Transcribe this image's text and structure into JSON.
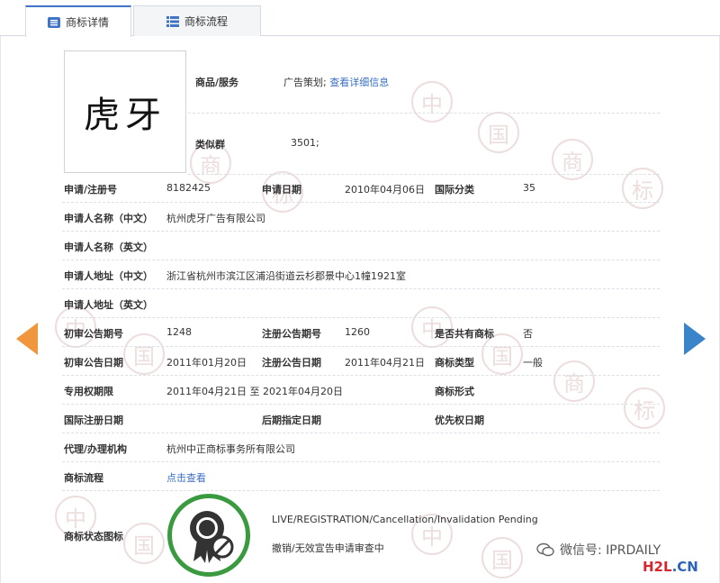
{
  "tabs": [
    {
      "label": "商标详情",
      "active": true,
      "icon": "list-icon"
    },
    {
      "label": "商标流程",
      "active": false,
      "icon": "grid-list-icon"
    }
  ],
  "trademark_image_text": "虎牙",
  "watermark_chars": [
    "中",
    "国",
    "商",
    "标"
  ],
  "goods_services": {
    "label": "商品/服务",
    "value": "广告策划;",
    "link": "查看详细信息"
  },
  "similar_group": {
    "label": "类似群",
    "value": "3501;"
  },
  "rows": {
    "reg_no": {
      "label": "申请/注册号",
      "value": "8182425"
    },
    "app_date": {
      "label": "申请日期",
      "value": "2010年04月06日"
    },
    "intl_class": {
      "label": "国际分类",
      "value": "35"
    },
    "applicant_cn": {
      "label": "申请人名称（中文）",
      "value": "杭州虎牙广告有限公司"
    },
    "applicant_en": {
      "label": "申请人名称（英文）",
      "value": ""
    },
    "address_cn": {
      "label": "申请人地址（中文）",
      "value": "浙江省杭州市滨江区浦沿街道云杉郡景中心1幢1921室"
    },
    "address_en": {
      "label": "申请人地址（英文）",
      "value": ""
    },
    "prelim_no": {
      "label": "初审公告期号",
      "value": "1248"
    },
    "reg_pub_no": {
      "label": "注册公告期号",
      "value": "1260"
    },
    "shared": {
      "label": "是否共有商标",
      "value": "否"
    },
    "prelim_date": {
      "label": "初审公告日期",
      "value": "2011年01月20日"
    },
    "reg_pub_date": {
      "label": "注册公告日期",
      "value": "2011年04月21日"
    },
    "tm_type": {
      "label": "商标类型",
      "value": "一般"
    },
    "exclusive_period": {
      "label": "专用权期限",
      "value": "2011年04月21日 至 2021年04月20日"
    },
    "tm_form": {
      "label": "商标形式",
      "value": ""
    },
    "intl_reg_date": {
      "label": "国际注册日期",
      "value": ""
    },
    "later_designation": {
      "label": "后期指定日期",
      "value": ""
    },
    "priority_date": {
      "label": "优先权日期",
      "value": ""
    },
    "agent": {
      "label": "代理/办理机构",
      "value": "杭州中正商标事务所有限公司"
    },
    "process": {
      "label": "商标流程",
      "link": "点击查看"
    },
    "status_icon": {
      "label": "商标状态图标"
    }
  },
  "status": {
    "en": "LIVE/REGISTRATION/Cancellation/Invalidation Pending",
    "cn": "撤销/无效宣告申请审查中",
    "icon": "award-ribbon-blocked-icon",
    "color": "#3a9a3f"
  },
  "nav": {
    "prev_icon": "arrow-left-icon",
    "next_icon": "arrow-right-icon",
    "prev_color": "#f0963c",
    "next_color": "#3a84c9"
  },
  "watermark": {
    "wechat": "微信号: IPRDAILY",
    "site_h2l": "H2L",
    "site_cn": ".CN"
  },
  "colors": {
    "accent": "#3f74c8",
    "link": "#3a6fc4"
  }
}
